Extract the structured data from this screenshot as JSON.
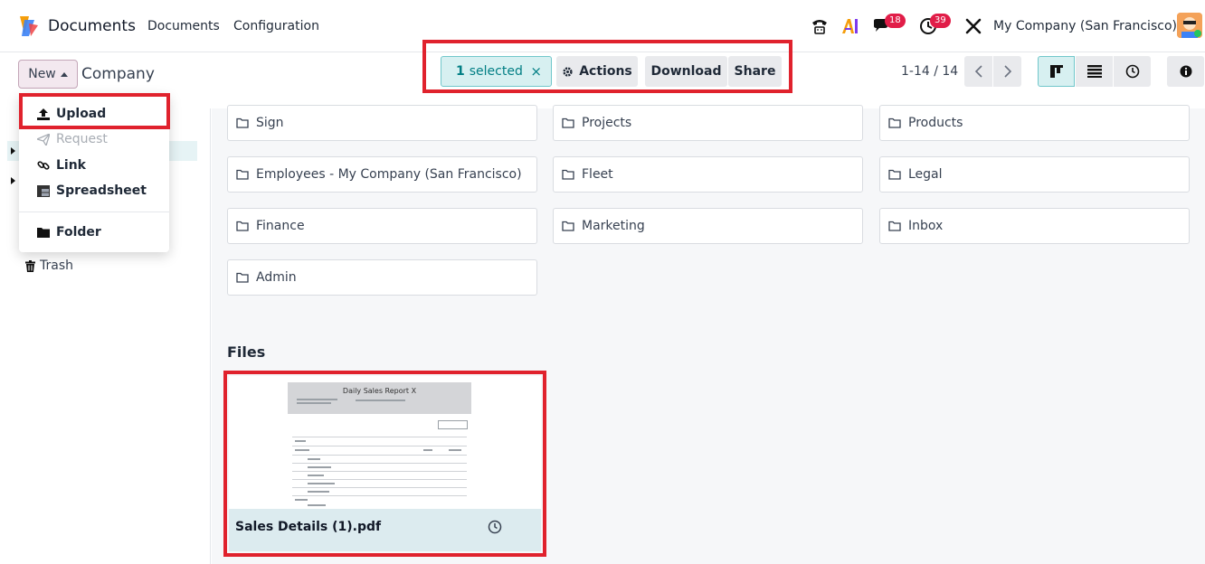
{
  "navbar": {
    "app_name": "Documents",
    "menu": [
      "Documents",
      "Configuration"
    ],
    "messages_badge": "18",
    "activities_badge": "39",
    "company": "My Company (San Francisco)",
    "icons": [
      "phone-icon",
      "ai-icon",
      "chat-icon",
      "clock-icon",
      "tools-icon"
    ]
  },
  "control_panel": {
    "new_label": "New",
    "breadcrumb": "Company",
    "selected_count": "1",
    "selected_label": "selected",
    "clear_icon": "×",
    "actions_label": "Actions",
    "download_label": "Download",
    "share_label": "Share",
    "pager": "1-14 / 14"
  },
  "new_menu": {
    "items": [
      {
        "label": "Upload",
        "icon": "upload-icon",
        "enabled": true
      },
      {
        "label": "Request",
        "icon": "paper-plane-icon",
        "enabled": false
      },
      {
        "label": "Link",
        "icon": "link-icon",
        "enabled": true
      },
      {
        "label": "Spreadsheet",
        "icon": "spreadsheet-icon",
        "enabled": true
      },
      {
        "label": "Folder",
        "icon": "folder-icon",
        "enabled": true
      }
    ]
  },
  "sidebar": {
    "trash_label": "Trash"
  },
  "folders": [
    "Sign",
    "Projects",
    "Products",
    "Employees - My Company (San Francisco)",
    "Fleet",
    "Legal",
    "Finance",
    "Marketing",
    "Inbox",
    "Admin"
  ],
  "files": {
    "title": "Files",
    "items": [
      {
        "name": "Sales Details (1).pdf",
        "preview_title": "Daily Sales Report X"
      }
    ]
  },
  "colors": {
    "accent": "#017e84",
    "highlight_frame": "#e0222d",
    "badge": "#e11d48"
  }
}
